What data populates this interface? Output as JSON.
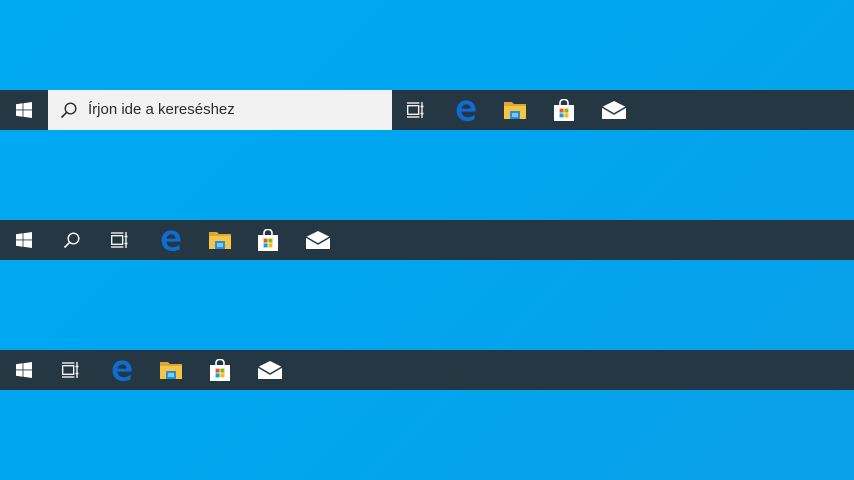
{
  "desktop": {
    "background_color": "#00a8f0"
  },
  "taskbars": [
    {
      "variant": "search-box",
      "search": {
        "placeholder": "Írjon ide a kereséshez"
      },
      "icons": [
        "windows-start-icon",
        "search-icon",
        "task-view-icon",
        "edge-icon",
        "file-explorer-icon",
        "store-icon",
        "mail-icon"
      ]
    },
    {
      "variant": "search-icon",
      "icons": [
        "windows-start-icon",
        "search-icon",
        "task-view-icon",
        "edge-icon",
        "file-explorer-icon",
        "store-icon",
        "mail-icon"
      ]
    },
    {
      "variant": "hidden-search",
      "icons": [
        "windows-start-icon",
        "task-view-icon",
        "edge-icon",
        "file-explorer-icon",
        "store-icon",
        "mail-icon"
      ]
    }
  ],
  "colors": {
    "taskbar": "#243742",
    "search_box": "#f2f2f2",
    "edge_blue": "#0f6cd1",
    "folder_yellow": "#f5c644",
    "store_red": "#f35325",
    "store_green": "#81bc06",
    "store_blue": "#05a6f0",
    "store_yellow": "#ffba08"
  }
}
